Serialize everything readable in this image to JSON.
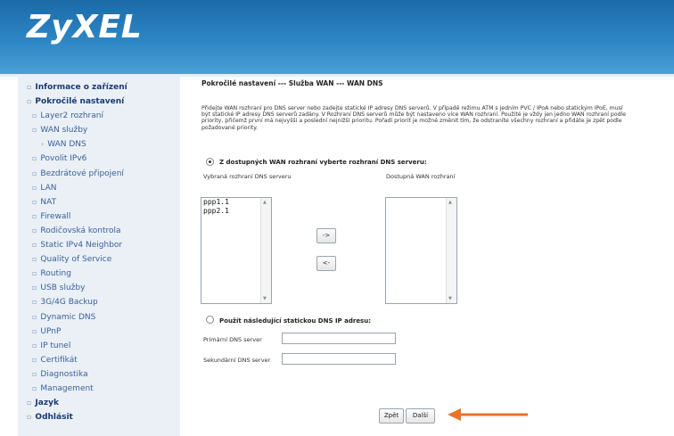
{
  "header": {
    "brand": "ZyXEL"
  },
  "sidebar": {
    "items": [
      {
        "label": "Informace o zařízení",
        "level": "top"
      },
      {
        "label": "Pokročilé nastavení",
        "level": "top"
      },
      {
        "label": "Layer2 rozhraní",
        "level": "sub"
      },
      {
        "label": "WAN služby",
        "level": "sub"
      },
      {
        "label": "WAN DNS",
        "level": "subsub"
      },
      {
        "label": "Povolit IPv6",
        "level": "sub"
      },
      {
        "label": "Bezdrátové připojení",
        "level": "sub"
      },
      {
        "label": "LAN",
        "level": "sub"
      },
      {
        "label": "NAT",
        "level": "sub"
      },
      {
        "label": "Firewall",
        "level": "sub"
      },
      {
        "label": "Rodičovská kontrola",
        "level": "sub"
      },
      {
        "label": "Static IPv4 Neighbor",
        "level": "sub"
      },
      {
        "label": "Quality of Service",
        "level": "sub"
      },
      {
        "label": "Routing",
        "level": "sub"
      },
      {
        "label": "USB služby",
        "level": "sub"
      },
      {
        "label": "3G/4G Backup",
        "level": "sub"
      },
      {
        "label": "Dynamic DNS",
        "level": "sub"
      },
      {
        "label": "UPnP",
        "level": "sub"
      },
      {
        "label": "IP tunel",
        "level": "sub"
      },
      {
        "label": "Certifikát",
        "level": "sub"
      },
      {
        "label": "Diagnostika",
        "level": "sub"
      },
      {
        "label": "Management",
        "level": "sub"
      },
      {
        "label": "Jazyk",
        "level": "top"
      },
      {
        "label": "Odhlásit",
        "level": "top"
      }
    ]
  },
  "main": {
    "title": "Pokročilé nastavení --- Služba WAN --- WAN DNS",
    "description": "Přidejte WAN rozhraní pro DNS server nebo zadejte statické IP adresy DNS serverů. V případě režimu ATM s jedním PVC / IPoA nebo statickým IPoE, musí být statické IP adresy DNS serverů zadány. V Rozhraní DNS serverů může být nastaveno více WAN rozhraní. Použité je vždy jen jedno WAN rozhraní podle priority, přičemž první má nejvyšší a poslední nejnižší prioritu. Pořadí priorit je možné změnit tím, že odstraníte všechny rozhraní a přidáte je zpět podle požadované priority.",
    "option_dynamic": {
      "label": "Z dostupných WAN rozhraní vyberte rozhraní DNS serveru:",
      "selected": true
    },
    "selected_list": {
      "label": "Vybraná rozhraní DNS serveru",
      "items": [
        "ppp1.1",
        "ppp2.1"
      ]
    },
    "available_list": {
      "label": "Dostupná WAN rozhraní",
      "items": []
    },
    "move_right_label": "->",
    "move_left_label": "<-",
    "option_static": {
      "label": "Použít následující statickou DNS IP adresu:",
      "selected": false
    },
    "primary_dns": {
      "label": "Primární DNS server",
      "value": ""
    },
    "secondary_dns": {
      "label": "Sekundární DNS server",
      "value": ""
    },
    "back_label": "Zpět",
    "next_label": "Další"
  },
  "colors": {
    "banner": "#2d86c4",
    "arrow": "#e8742a",
    "menu_text": "#1e4b8f"
  }
}
